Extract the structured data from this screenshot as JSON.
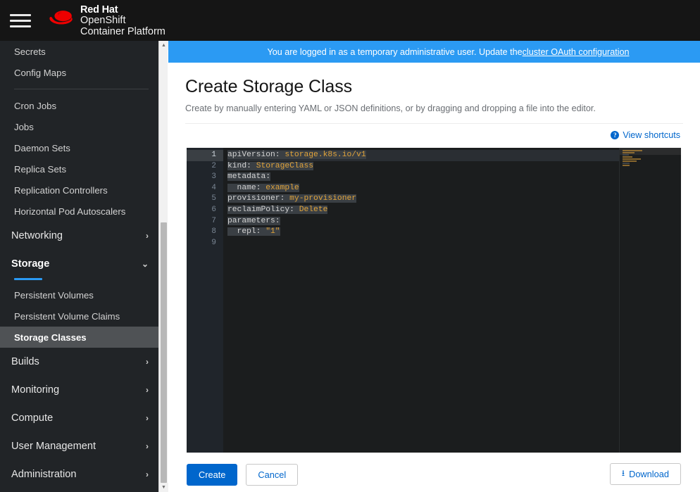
{
  "masthead": {
    "menu_icon": "hamburger-menu-icon",
    "logo_icon": "red-hat-fedora-logo",
    "brand_line1": "Red Hat",
    "brand_line2": "OpenShift",
    "brand_line3": "Container Platform"
  },
  "banner": {
    "text": "You are logged in as a temporary administrative user. Update the ",
    "link_text": "cluster OAuth configuration",
    "background": "#2b9af3"
  },
  "sidebar": {
    "items": [
      {
        "label": "Secrets",
        "type": "sub"
      },
      {
        "label": "Config Maps",
        "type": "sub"
      },
      {
        "label": "__divider__",
        "type": "divider"
      },
      {
        "label": "Cron Jobs",
        "type": "sub"
      },
      {
        "label": "Jobs",
        "type": "sub"
      },
      {
        "label": "Daemon Sets",
        "type": "sub"
      },
      {
        "label": "Replica Sets",
        "type": "sub"
      },
      {
        "label": "Replication Controllers",
        "type": "sub"
      },
      {
        "label": "Horizontal Pod Autoscalers",
        "type": "sub"
      },
      {
        "label": "Networking",
        "type": "section",
        "expanded": false,
        "chevron": "chevron-right-icon"
      },
      {
        "label": "Storage",
        "type": "section",
        "expanded": true,
        "active": true,
        "chevron": "chevron-down-icon"
      },
      {
        "label": "Persistent Volumes",
        "type": "sub"
      },
      {
        "label": "Persistent Volume Claims",
        "type": "sub"
      },
      {
        "label": "Storage Classes",
        "type": "sub",
        "selected": true
      },
      {
        "label": "Builds",
        "type": "section",
        "expanded": false,
        "chevron": "chevron-right-icon"
      },
      {
        "label": "Monitoring",
        "type": "section",
        "expanded": false,
        "chevron": "chevron-right-icon"
      },
      {
        "label": "Compute",
        "type": "section",
        "expanded": false,
        "chevron": "chevron-right-icon"
      },
      {
        "label": "User Management",
        "type": "section",
        "expanded": false,
        "chevron": "chevron-right-icon"
      },
      {
        "label": "Administration",
        "type": "section",
        "expanded": false,
        "chevron": "chevron-right-icon"
      }
    ],
    "accent_color": "#2b9af3",
    "scroll_up_icon": "scroll-up-arrow",
    "scroll_down_icon": "scroll-down-arrow"
  },
  "page": {
    "title": "Create Storage Class",
    "subtitle": "Create by manually entering YAML or JSON definitions, or by dragging and dropping a file into the editor."
  },
  "shortcuts": {
    "icon": "help-circle-icon",
    "label": "View shortcuts",
    "color": "#0066cc"
  },
  "editor": {
    "language": "yaml",
    "current_line": 1,
    "line_count": 9,
    "lines": [
      {
        "n": 1,
        "key": "apiVersion",
        "sep": ": ",
        "value": "storage.k8s.io/v1",
        "indent": 0
      },
      {
        "n": 2,
        "key": "kind",
        "sep": ": ",
        "value": "StorageClass",
        "indent": 0
      },
      {
        "n": 3,
        "key": "metadata",
        "sep": ":",
        "value": "",
        "indent": 0
      },
      {
        "n": 4,
        "key": "name",
        "sep": ": ",
        "value": "example",
        "indent": 2
      },
      {
        "n": 5,
        "key": "provisioner",
        "sep": ": ",
        "value": "my-provisioner",
        "indent": 0
      },
      {
        "n": 6,
        "key": "reclaimPolicy",
        "sep": ": ",
        "value": "Delete",
        "indent": 0
      },
      {
        "n": 7,
        "key": "parameters",
        "sep": ":",
        "value": "",
        "indent": 0
      },
      {
        "n": 8,
        "key": "repl",
        "sep": ": ",
        "value": "\"1\"",
        "indent": 2
      },
      {
        "n": 9,
        "key": "",
        "sep": "",
        "value": "",
        "indent": 0
      }
    ],
    "key_color": "#d4d4d4",
    "value_color": "#e0a33a",
    "background": "#1b1d1e",
    "gutter_background": "#20252b"
  },
  "actions": {
    "create_label": "Create",
    "cancel_label": "Cancel",
    "download_label": "Download",
    "download_icon": "download-icon",
    "primary_color": "#0066cc"
  }
}
